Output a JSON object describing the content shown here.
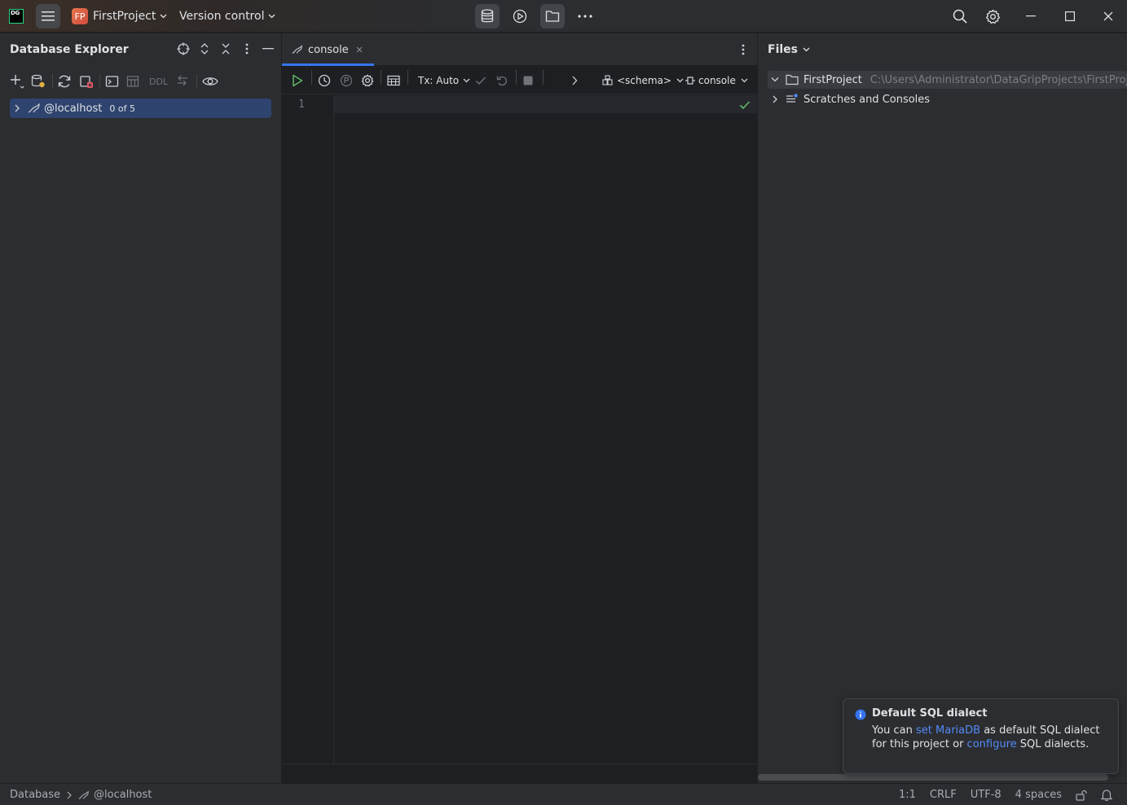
{
  "titlebar": {
    "app_logo": "DG",
    "project_badge": "FP",
    "project_name": "FirstProject",
    "vcs_label": "Version control",
    "center_icons": [
      "database-icon",
      "run-icon",
      "folder-icon",
      "more-icon"
    ],
    "right_icons": [
      "search-icon",
      "settings-icon"
    ],
    "window_controls": [
      "minimize-icon",
      "maximize-icon",
      "close-icon"
    ]
  },
  "db_explorer": {
    "title": "Database Explorer",
    "toolbar_icons": [
      "add-icon",
      "datasource-properties-icon",
      "refresh-icon",
      "disconnect-icon",
      "console-icon",
      "table-icon",
      "ddl-icon",
      "jump-icon",
      "view-icon"
    ],
    "ddl_label": "DDL",
    "tree": [
      {
        "label": "@localhost",
        "count": "0 of 5",
        "selected": true
      }
    ]
  },
  "editor": {
    "tab": {
      "label": "console",
      "active": true
    },
    "tx_label": "Tx: Auto",
    "schema_label": "<schema>",
    "session_label": "console",
    "line_numbers": [
      "1"
    ]
  },
  "files": {
    "title": "Files",
    "rows": [
      {
        "name": "FirstProject",
        "path": "C:\\Users\\Administrator\\DataGripProjects\\FirstProje",
        "expanded": true,
        "selected": true
      },
      {
        "name": "Scratches and Consoles",
        "path": "",
        "expanded": false,
        "selected": false
      }
    ]
  },
  "notification": {
    "title": "Default SQL dialect",
    "text_1": "You can ",
    "link_1": "set MariaDB",
    "text_2": " as default SQL dialect for this project or ",
    "link_2": "configure",
    "text_3": " SQL dialects."
  },
  "statusbar": {
    "breadcrumb": [
      "Database",
      "@localhost"
    ],
    "position": "1:1",
    "line_sep": "CRLF",
    "encoding": "UTF-8",
    "indent": "4 spaces"
  },
  "colors": {
    "accent": "#3574f0",
    "selection": "#2e436e",
    "link": "#548af7",
    "run_green": "#5fb865"
  }
}
